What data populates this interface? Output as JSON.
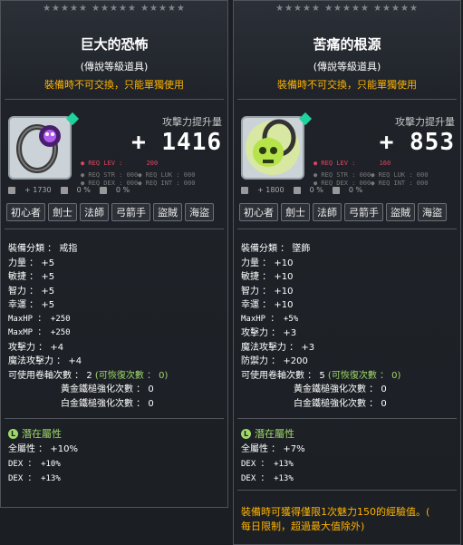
{
  "card_a": {
    "title": "巨大的恐怖",
    "subtitle": "(傳說等級道具)",
    "warning": "裝備時不可交換，只能單獨使用",
    "attack_gain_label": "攻擊力提升量",
    "attack_gain_value": "+ 1416",
    "req_lev_label": "● REQ LEV :",
    "req_lev_value": "200",
    "req_str": "● REQ STR : 000● REQ LUK : 000",
    "req_dex": "● REQ DEX : 000● REQ INT : 000",
    "mini_stats": [
      "+ 1730",
      "0 %",
      "0 %"
    ],
    "jobs": [
      "初心者",
      "劍士",
      "法師",
      "弓箭手",
      "盜賊",
      "海盜"
    ],
    "stats": [
      "裝備分類 ： 戒指",
      "力量 ： +5",
      "敏捷 ： +5",
      "智力 ： +5",
      "幸運 ： +5",
      "MaxHP ： +250",
      "MaxMP ： +250",
      "攻擊力 ： +4",
      "魔法攻擊力 ： +4"
    ],
    "scroll_line": "可使用卷軸次數 ： 2",
    "scroll_recover": "(可恢復次數 ： 0)",
    "gold_hammer": "黃金鐵槌強化次數 ： 0",
    "plat_hammer": "白金鐵槌強化次數 ： 0",
    "potential_title": "潛在屬性",
    "potential": [
      "全屬性 ： +10%",
      "DEX ： +10%",
      "DEX ： +13%"
    ]
  },
  "card_b": {
    "title": "苦痛的根源",
    "subtitle": "(傳說等級道具)",
    "warning": "裝備時不可交換，只能單獨使用",
    "attack_gain_label": "攻擊力提升量",
    "attack_gain_value": "+ 853",
    "req_lev_label": "● REQ LEV :",
    "req_lev_value": "160",
    "req_str": "● REQ STR : 000● REQ LUK : 000",
    "req_dex": "● REQ DEX : 000● REQ INT : 000",
    "mini_stats": [
      "+ 1800",
      "0 %",
      "0 %"
    ],
    "jobs": [
      "初心者",
      "劍士",
      "法師",
      "弓箭手",
      "盜賊",
      "海盜"
    ],
    "stats": [
      "裝備分類 ： 墜飾",
      "力量 ： +10",
      "敏捷 ： +10",
      "智力 ： +10",
      "幸運 ： +10",
      "MaxHP ： +5%",
      "攻擊力 ： +3",
      "魔法攻擊力 ： +3",
      "防禦力 ： +200"
    ],
    "scroll_line": "可使用卷軸次數 ： 5",
    "scroll_recover": "(可恢復次數 ： 0)",
    "gold_hammer": "黃金鐵槌強化次數 ： 0",
    "plat_hammer": "白金鐵槌強化次數 ： 0",
    "potential_title": "潛在屬性",
    "potential": [
      "全屬性 ： +7%",
      "DEX ： +13%",
      "DEX ： +13%"
    ],
    "note_line1": "裝備時可獲得僅限1次魅力150的經驗值。(",
    "note_line2": "每日限制，超過最大值除外)"
  },
  "icons": {
    "ring": "ring-icon",
    "pendant": "skull-pendant-icon"
  },
  "colors": {
    "warning": "#ffb300",
    "req_level": "#e0445f",
    "potential": "#9fd86b"
  }
}
